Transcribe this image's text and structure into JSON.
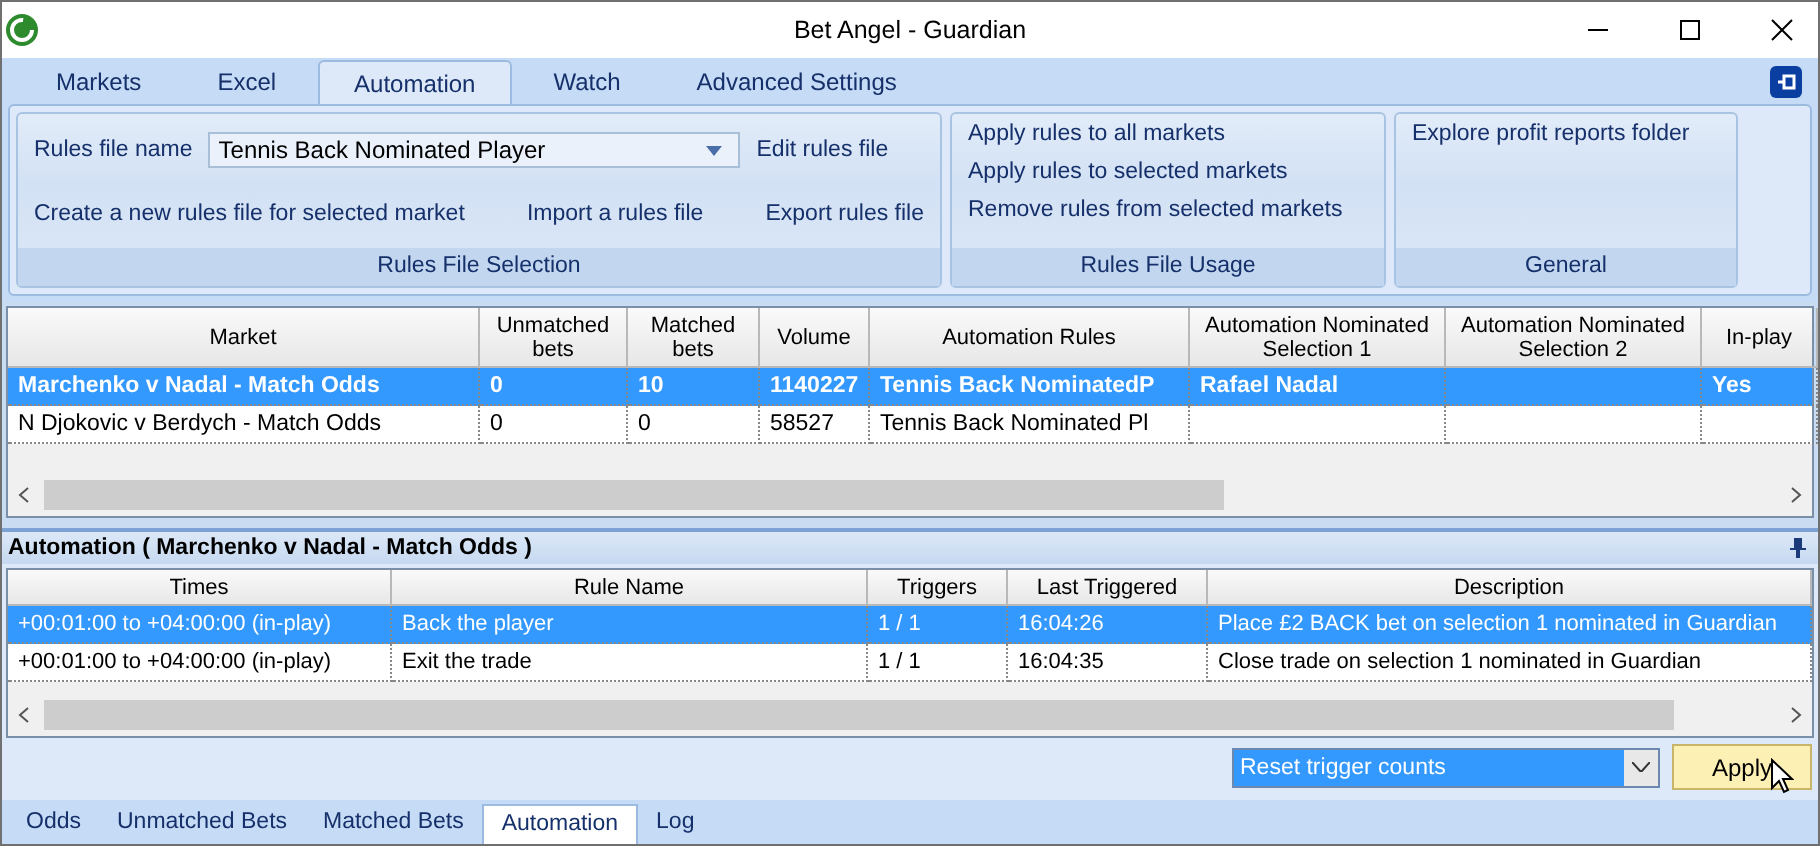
{
  "window": {
    "title": "Bet Angel - Guardian"
  },
  "ribbon": {
    "tabs": [
      {
        "label": "Markets",
        "selected": false
      },
      {
        "label": "Excel",
        "selected": false
      },
      {
        "label": "Automation",
        "selected": true
      },
      {
        "label": "Watch",
        "selected": false
      },
      {
        "label": "Advanced Settings",
        "selected": false
      }
    ],
    "rules_file_selection": {
      "label": "Rules file name",
      "value": "Tennis Back Nominated Player",
      "edit": "Edit rules file",
      "actions": [
        "Create a new rules file for selected market",
        "Import a rules file",
        "Export rules file"
      ],
      "caption": "Rules File Selection"
    },
    "rules_file_usage": {
      "actions": [
        "Apply rules to all markets",
        "Apply rules to selected markets",
        "Remove rules from selected markets"
      ],
      "caption": "Rules File Usage"
    },
    "general": {
      "actions": [
        "Explore profit reports folder"
      ],
      "caption": "General"
    }
  },
  "markets": {
    "columns": [
      "Market",
      "Unmatched bets",
      "Matched bets",
      "Volume",
      "Automation Rules",
      "Automation Nominated Selection 1",
      "Automation Nominated Selection 2",
      "In-play"
    ],
    "rows": [
      {
        "selected": true,
        "cells": [
          "Marchenko v Nadal - Match Odds",
          "0",
          "10",
          "1140227",
          "Tennis Back NominatedP",
          "Rafael Nadal",
          null,
          "Yes"
        ]
      },
      {
        "selected": false,
        "cells": [
          "N Djokovic v Berdych - Match Odds",
          "0",
          "0",
          "58527",
          "Tennis Back Nominated Pl",
          null,
          null,
          null
        ]
      }
    ]
  },
  "automation": {
    "title": "Automation ( Marchenko v Nadal - Match Odds )",
    "columns": [
      "Times",
      "Rule Name",
      "Triggers",
      "Last Triggered",
      "Description"
    ],
    "rows": [
      {
        "selected": true,
        "cells": [
          "+00:01:00 to +04:00:00 (in-play)",
          "Back the player",
          "1 / 1",
          "16:04:26",
          "Place £2 BACK bet on selection 1 nominated in Guardian"
        ]
      },
      {
        "selected": false,
        "cells": [
          "+00:01:00 to +04:00:00 (in-play)",
          "Exit the trade",
          "1 / 1",
          "16:04:35",
          "Close trade on selection 1 nominated in Guardian"
        ]
      }
    ],
    "action_dropdown": {
      "value": "Reset trigger counts"
    },
    "apply_button": "Apply"
  },
  "bottom_tabs": [
    {
      "label": "Odds",
      "selected": false
    },
    {
      "label": "Unmatched Bets",
      "selected": false
    },
    {
      "label": "Matched Bets",
      "selected": false
    },
    {
      "label": "Automation",
      "selected": true
    },
    {
      "label": "Log",
      "selected": false
    }
  ]
}
